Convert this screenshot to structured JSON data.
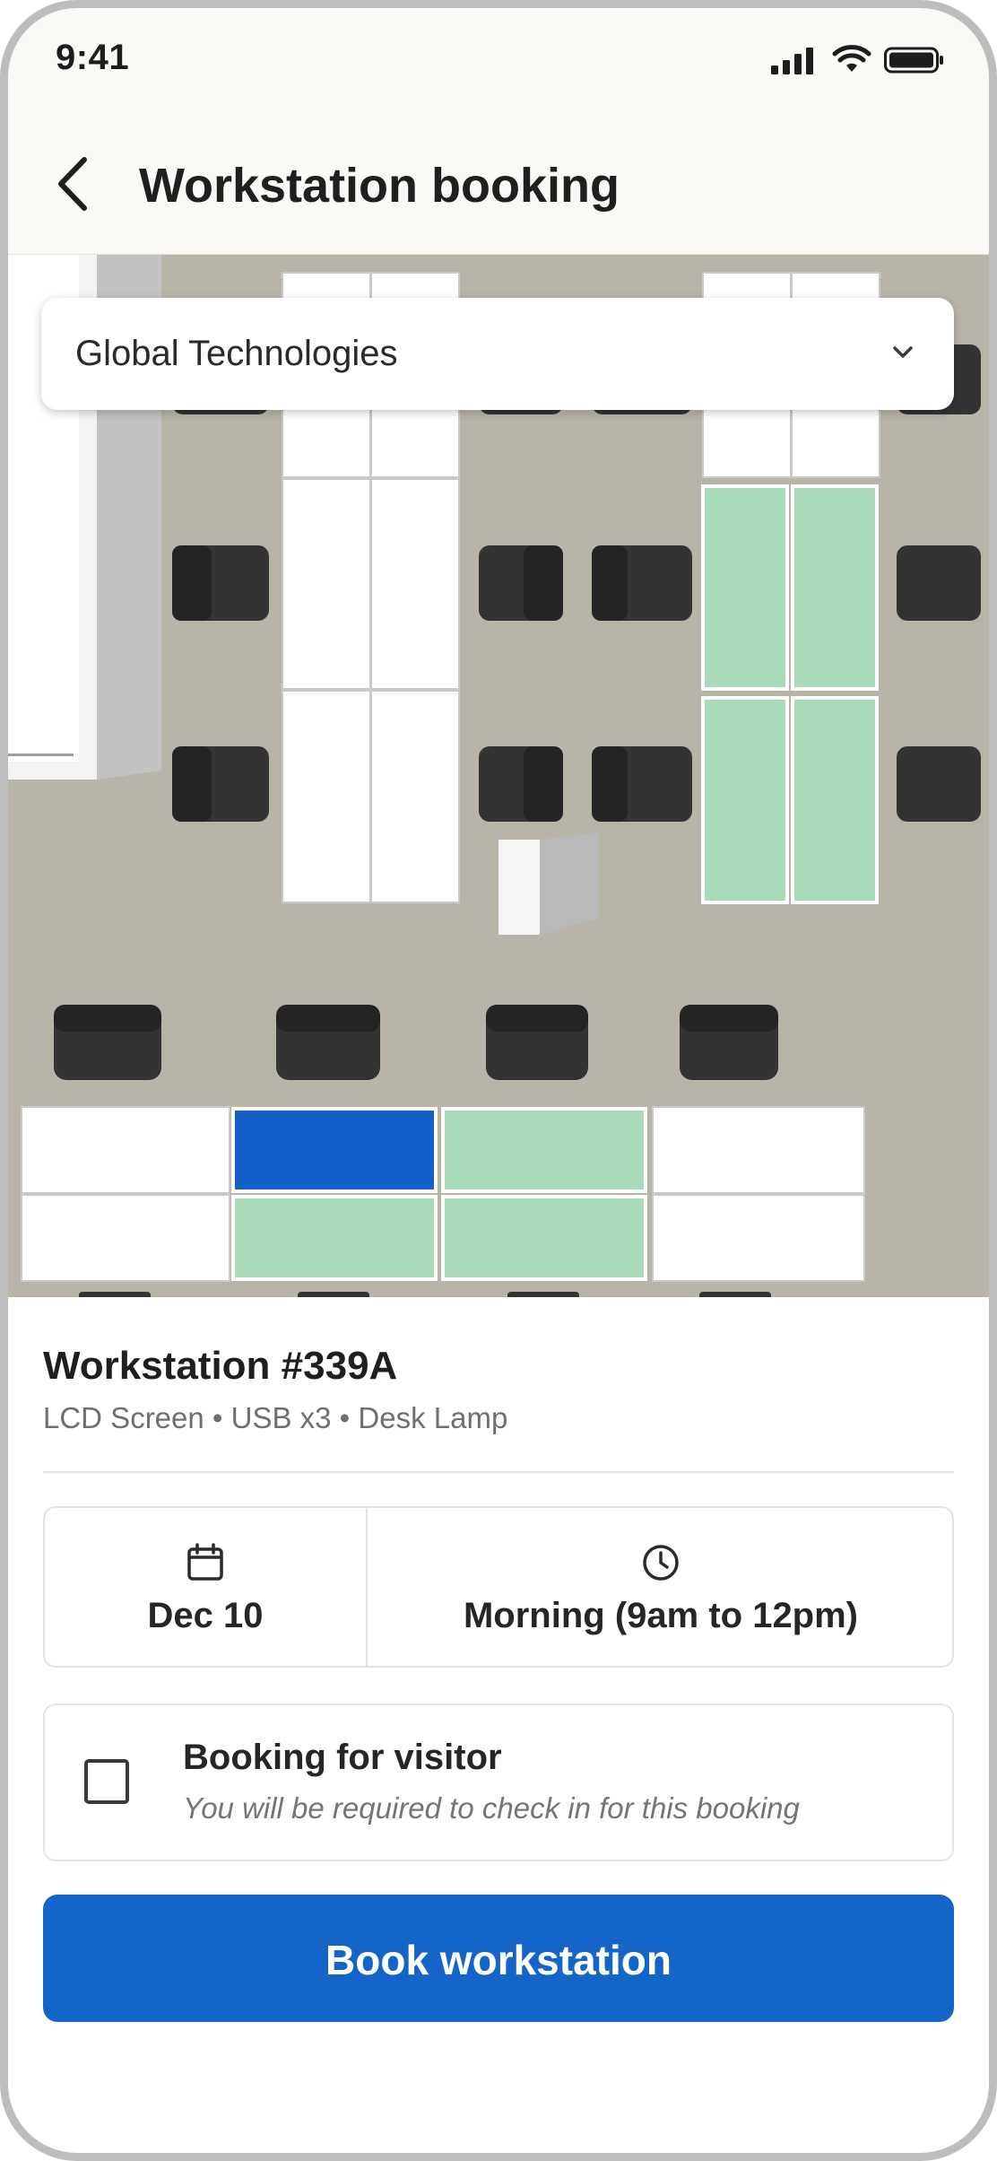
{
  "status_bar": {
    "time": "9:41"
  },
  "header": {
    "title": "Workstation booking",
    "back_icon": "chevron-left-icon"
  },
  "location_select": {
    "selected": "Global Technologies",
    "icon": "chevron-down-icon"
  },
  "floor_map": {
    "colors": {
      "floor": "#b8b4a8",
      "desk_unavailable": "#ffffff",
      "desk_available": "#a9dbb8",
      "desk_selected": "#1460c8",
      "chair": "#333333"
    }
  },
  "workstation": {
    "title": "Workstation #339A",
    "features": "LCD Screen • USB x3 • Desk Lamp"
  },
  "booking_time": {
    "date": "Dec 10",
    "date_icon": "calendar-icon",
    "slot": "Morning (9am to 12pm)",
    "slot_icon": "clock-icon"
  },
  "visitor": {
    "checked": false,
    "title": "Booking for visitor",
    "subtitle": "You will be required to check in for this booking"
  },
  "primary_action": {
    "label": "Book workstation",
    "color": "#1565c9"
  }
}
